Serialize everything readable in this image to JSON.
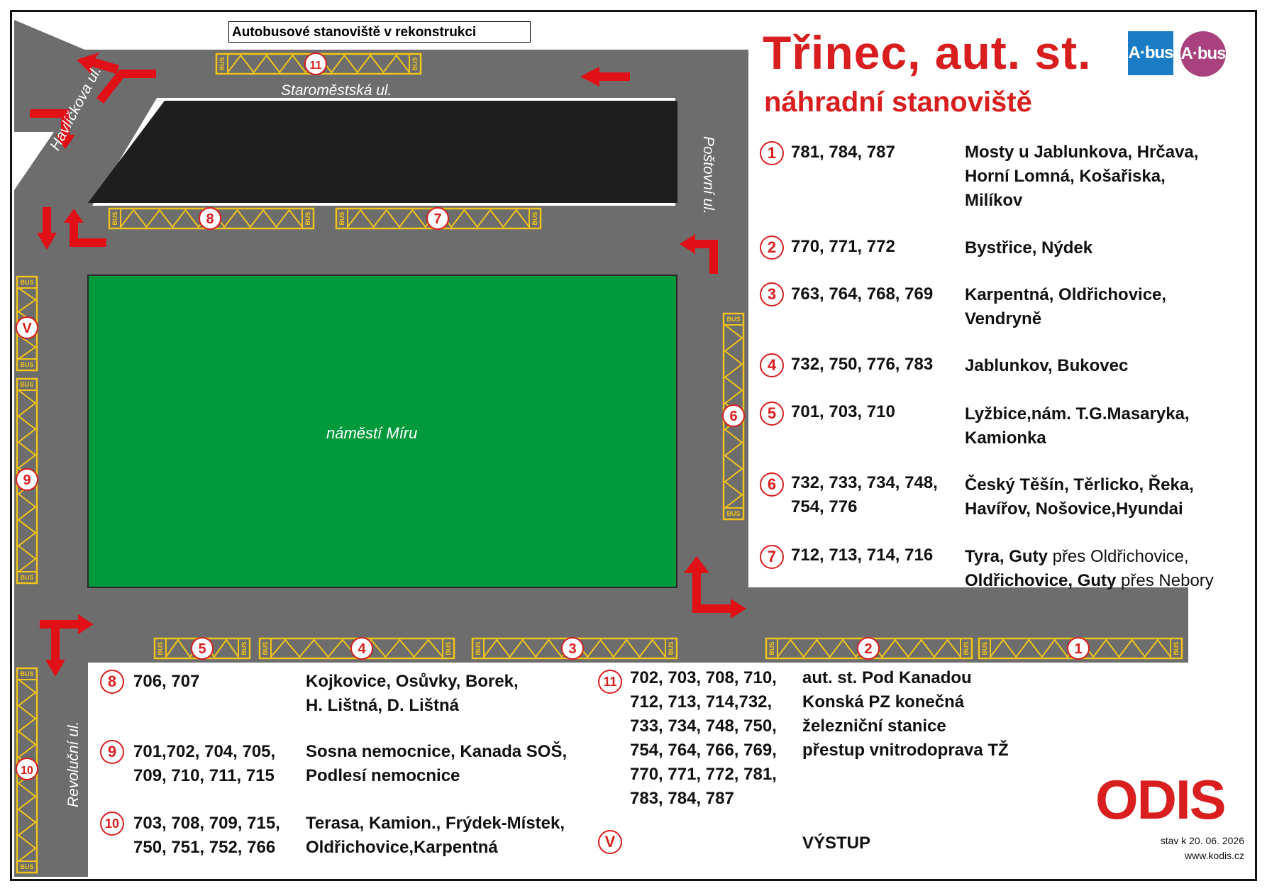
{
  "notice": "Autobusové stanoviště v rekonstrukci",
  "title": "Třinec, aut. st.",
  "subtitle": "náhradní stanoviště",
  "logos": [
    {
      "text": "A·bus",
      "color": "#1a7dc4"
    },
    {
      "text": "A·bus",
      "color": "#a8417d"
    }
  ],
  "streets": {
    "staromestska": "Staroměstská ul.",
    "havlickova": "Havlíčkova ul.",
    "postovni": "Poštovní ul.",
    "revolucni": "Revoluční ul.",
    "square": "náměstí Míru"
  },
  "bus_label": "BUS",
  "right_list": [
    {
      "num": "1",
      "lines": [
        "781, 784, 787"
      ],
      "dest": [
        "Mosty u Jablunkova, Hrčava,",
        "Horní Lomná, Košařiska,",
        "Milíkov"
      ]
    },
    {
      "num": "2",
      "lines": [
        "770, 771, 772"
      ],
      "dest": [
        "Bystřice, Nýdek"
      ]
    },
    {
      "num": "3",
      "lines": [
        "763, 764, 768, 769"
      ],
      "dest": [
        "Karpentná, Oldřichovice,",
        "Vendryně"
      ]
    },
    {
      "num": "4",
      "lines": [
        "732, 750, 776, 783"
      ],
      "dest": [
        "Jablunkov, Bukovec"
      ]
    },
    {
      "num": "5",
      "lines": [
        "701, 703, 710"
      ],
      "dest": [
        "Lyžbice,nám. T.G.Masaryka,",
        "Kamionka"
      ]
    },
    {
      "num": "6",
      "lines": [
        "732, 733, 734, 748,",
        "754, 776"
      ],
      "dest": [
        "Český Těšín, Těrlicko, Řeka,",
        "Havířov, Nošovice,Hyundai"
      ]
    },
    {
      "num": "7",
      "lines": [
        "712, 713, 714, 716"
      ],
      "dest7": [
        {
          "bold": "Tyra, Guty",
          "via": " přes Oldřichovice",
          "end": ","
        },
        {
          "bold": "Oldřichovice, Guty",
          "via": " přes Nebory",
          "end": ""
        }
      ]
    }
  ],
  "bottom_list": [
    {
      "num": "8",
      "lines": [
        "706, 707"
      ],
      "dest": [
        "Kojkovice, Osůvky, Borek,",
        "H. Lištná, D. Lištná"
      ]
    },
    {
      "num": "9",
      "lines": [
        "701,702, 704, 705,",
        "709, 710, 711, 715"
      ],
      "dest": [
        "Sosna nemocnice, Kanada SOŠ,",
        "Podlesí nemocnice"
      ]
    },
    {
      "num": "10",
      "lines": [
        "703, 708, 709, 715,",
        "750, 751, 752, 766"
      ],
      "dest": [
        "Terasa, Kamion., Frýdek-Místek,",
        "Oldřichovice,Karpentná"
      ]
    }
  ],
  "stop11": {
    "num": "11",
    "lines": [
      "702, 703, 708, 710,",
      "712, 713, 714,732,",
      "733, 734, 748, 750,",
      "754, 764, 766, 769,",
      "770, 771, 772, 781,",
      "783, 784, 787"
    ],
    "dest": [
      "aut. st. Pod Kanadou",
      "Konská PZ konečná",
      "železniční stanice",
      "přestup vnitrodoprava TŽ"
    ]
  },
  "exit": {
    "num": "V",
    "label": "VÝSTUP"
  },
  "brand": "ODIS",
  "stand_date": "stav k 20. 06. 2026",
  "website": "www.kodis.cz",
  "colors": {
    "road": "#6d6d6d",
    "square": "#009a3d",
    "building": "#1e1e1e",
    "accent": "#d81e1e",
    "platform": "#f0c419"
  }
}
